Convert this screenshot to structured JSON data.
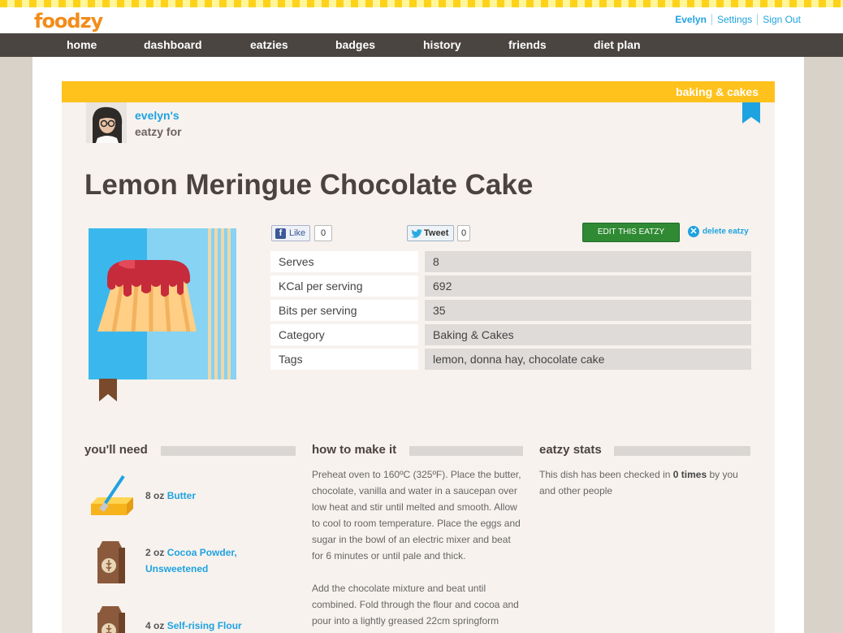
{
  "app": {
    "logo": "foodzy",
    "user_links": [
      "Evelyn",
      "Settings",
      "Sign Out"
    ]
  },
  "nav": {
    "items": [
      "home",
      "dashboard",
      "eatzies",
      "badges",
      "history",
      "friends",
      "diet plan"
    ]
  },
  "recipe": {
    "category": "baking & cakes",
    "owner": "evelyn's",
    "owner_sub": "eatzy for",
    "title": "Lemon Meringue Chocolate Cake",
    "social": {
      "like_label": "Like",
      "like_count": "0",
      "tweet_label": "Tweet",
      "tweet_count": "0"
    },
    "edit_label": "EDIT THIS EATZY",
    "delete_label": "delete eatzy",
    "facts": [
      {
        "key": "Serves",
        "value": "8"
      },
      {
        "key": "KCal per serving",
        "value": "692"
      },
      {
        "key": "Bits per serving",
        "value": "35"
      },
      {
        "key": "Category",
        "value": "Baking & Cakes"
      },
      {
        "key": "Tags",
        "value": "lemon, donna hay, chocolate cake"
      }
    ]
  },
  "sections": {
    "ingredients_title": "you'll need",
    "method_title": "how to make it",
    "stats_title": "eatzy stats"
  },
  "ingredients": [
    {
      "qty": "8 oz",
      "name": "Butter",
      "name2": "",
      "icon": "butter-icon"
    },
    {
      "qty": "2 oz",
      "name": "Cocoa Powder,",
      "name2": "Unsweetened",
      "icon": "flour-bag-icon"
    },
    {
      "qty": "4 oz",
      "name": "Self-rising Flour",
      "name2": "",
      "icon": "flour-bag-icon"
    }
  ],
  "method": {
    "p1": "Preheat oven to 160ºC (325ºF). Place the butter, chocolate, vanilla and water in a saucepan over low heat and stir until melted and smooth. Allow to cool to room temperature. Place the eggs and sugar in the bowl of an electric mixer and beat for 6 minutes or until pale and thick.",
    "p2": "Add the chocolate mixture and beat until combined. Fold through the flour and cocoa and pour into a lightly greased 22cm springform"
  },
  "stats": {
    "prefix": "This dish has been checked in",
    "count": "0 times",
    "suffix": "by you and other people"
  },
  "colors": {
    "accent_blue": "#1fa2e0",
    "brand_yellow": "#ffc21d",
    "nav_bg": "#4b4541",
    "edit_green": "#2f8a33"
  }
}
